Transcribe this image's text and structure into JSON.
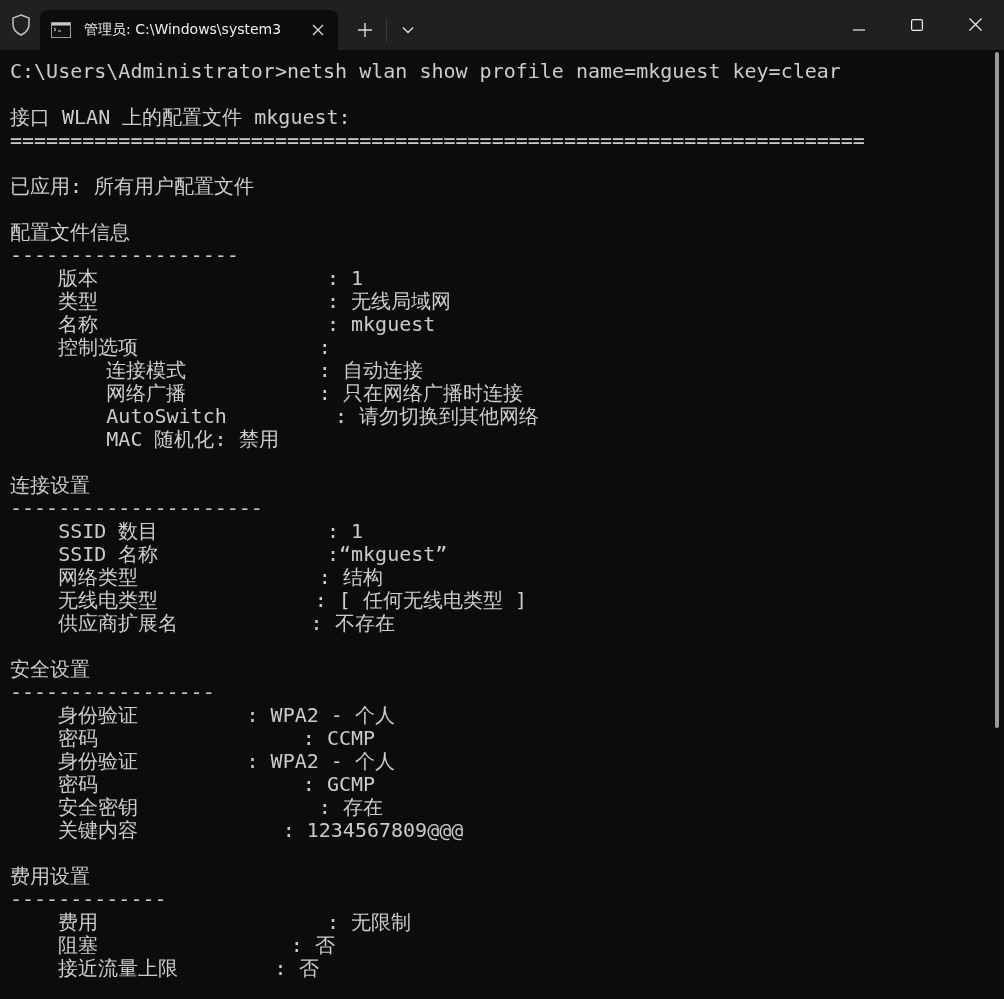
{
  "tab": {
    "title": "管理员: C:\\Windows\\system3"
  },
  "blocks": [
    {
      "lines": [
        "C:\\Users\\Administrator>netsh wlan show profile name=mkguest key=clear"
      ]
    },
    {
      "lines": [
        "接口 WLAN 上的配置文件 mkguest:",
        "======================================================================="
      ]
    },
    {
      "lines": [
        "已应用: 所有用户配置文件"
      ]
    },
    {
      "lines": [
        "配置文件信息",
        "-------------------",
        "    版本                   : 1",
        "    类型                   : 无线局域网",
        "    名称                   : mkguest",
        "    控制选项               :",
        "        连接模式           : 自动连接",
        "        网络广播           : 只在网络广播时连接",
        "        AutoSwitch         : 请勿切换到其他网络",
        "        MAC 随机化: 禁用"
      ]
    },
    {
      "lines": [
        "连接设置",
        "---------------------",
        "    SSID 数目              : 1",
        "    SSID 名称              :“mkguest”",
        "    网络类型               : 结构",
        "    无线电类型             : [ 任何无线电类型 ]",
        "    供应商扩展名           : 不存在"
      ]
    },
    {
      "lines": [
        "安全设置",
        "-----------------",
        "    身份验证         : WPA2 - 个人",
        "    密码                 : CCMP",
        "    身份验证         : WPA2 - 个人",
        "    密码                 : GCMP",
        "    安全密钥               : 存在",
        "    关键内容            : 1234567809@@@"
      ]
    },
    {
      "lines": [
        "费用设置",
        "-------------",
        "    费用                   : 无限制",
        "    阻塞                : 否",
        "    接近流量上限        : 否"
      ]
    }
  ]
}
